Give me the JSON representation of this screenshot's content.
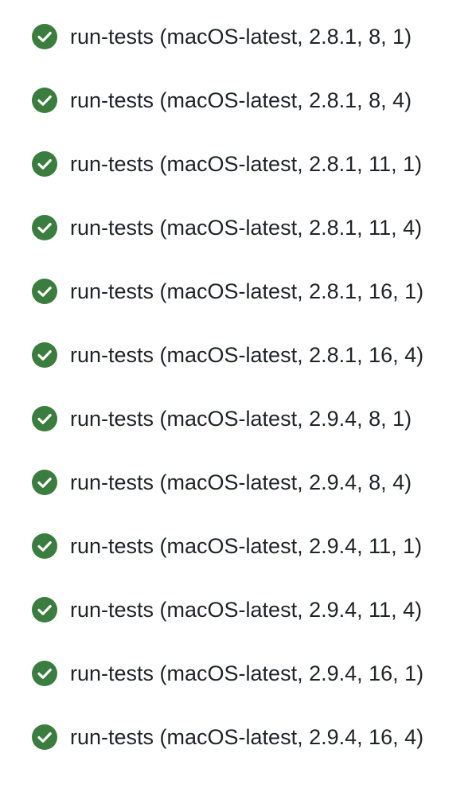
{
  "jobs": [
    {
      "name": "run-tests (macOS-latest, 2.8.1, 8, 1)",
      "status": "success",
      "icon": "check-circle-icon"
    },
    {
      "name": "run-tests (macOS-latest, 2.8.1, 8, 4)",
      "status": "success",
      "icon": "check-circle-icon"
    },
    {
      "name": "run-tests (macOS-latest, 2.8.1, 11, 1)",
      "status": "success",
      "icon": "check-circle-icon"
    },
    {
      "name": "run-tests (macOS-latest, 2.8.1, 11, 4)",
      "status": "success",
      "icon": "check-circle-icon"
    },
    {
      "name": "run-tests (macOS-latest, 2.8.1, 16, 1)",
      "status": "success",
      "icon": "check-circle-icon"
    },
    {
      "name": "run-tests (macOS-latest, 2.8.1, 16, 4)",
      "status": "success",
      "icon": "check-circle-icon"
    },
    {
      "name": "run-tests (macOS-latest, 2.9.4, 8, 1)",
      "status": "success",
      "icon": "check-circle-icon"
    },
    {
      "name": "run-tests (macOS-latest, 2.9.4, 8, 4)",
      "status": "success",
      "icon": "check-circle-icon"
    },
    {
      "name": "run-tests (macOS-latest, 2.9.4, 11, 1)",
      "status": "success",
      "icon": "check-circle-icon"
    },
    {
      "name": "run-tests (macOS-latest, 2.9.4, 11, 4)",
      "status": "success",
      "icon": "check-circle-icon"
    },
    {
      "name": "run-tests (macOS-latest, 2.9.4, 16, 1)",
      "status": "success",
      "icon": "check-circle-icon"
    },
    {
      "name": "run-tests (macOS-latest, 2.9.4, 16, 4)",
      "status": "success",
      "icon": "check-circle-icon"
    }
  ],
  "colors": {
    "success": "#3a7d3e",
    "text": "#1f2328"
  }
}
